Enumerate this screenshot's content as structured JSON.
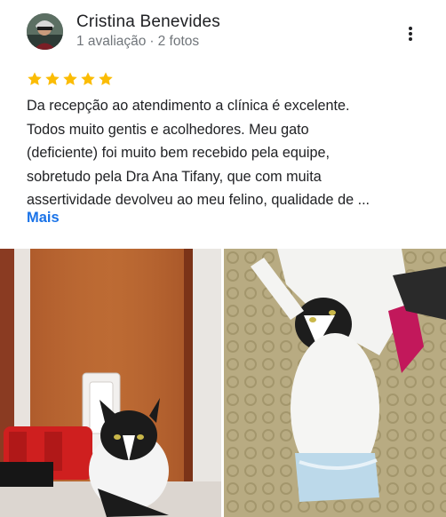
{
  "review": {
    "author_name": "Cristina Benevides",
    "review_count": "1 avaliação",
    "separator": "·",
    "photo_count": "2 fotos",
    "rating": 5,
    "rating_max": 5,
    "text_lines": [
      "Da recepção ao atendimento a clínica é excelente.",
      "Todos muito gentis e acolhedores. Meu gato",
      "(deficiente) foi muito bem recebido pela equipe,",
      "sobretudo pela Dra Ana Tifany, que com muita",
      "assertividade devolveu ao meu felino, qualidade de ..."
    ],
    "more_label": "Mais"
  },
  "icons": {
    "menu": "more-vert-icon",
    "star": "star-icon"
  },
  "colors": {
    "star": "#fbbc04",
    "link": "#1a73e8",
    "meta_text": "#70757a"
  }
}
